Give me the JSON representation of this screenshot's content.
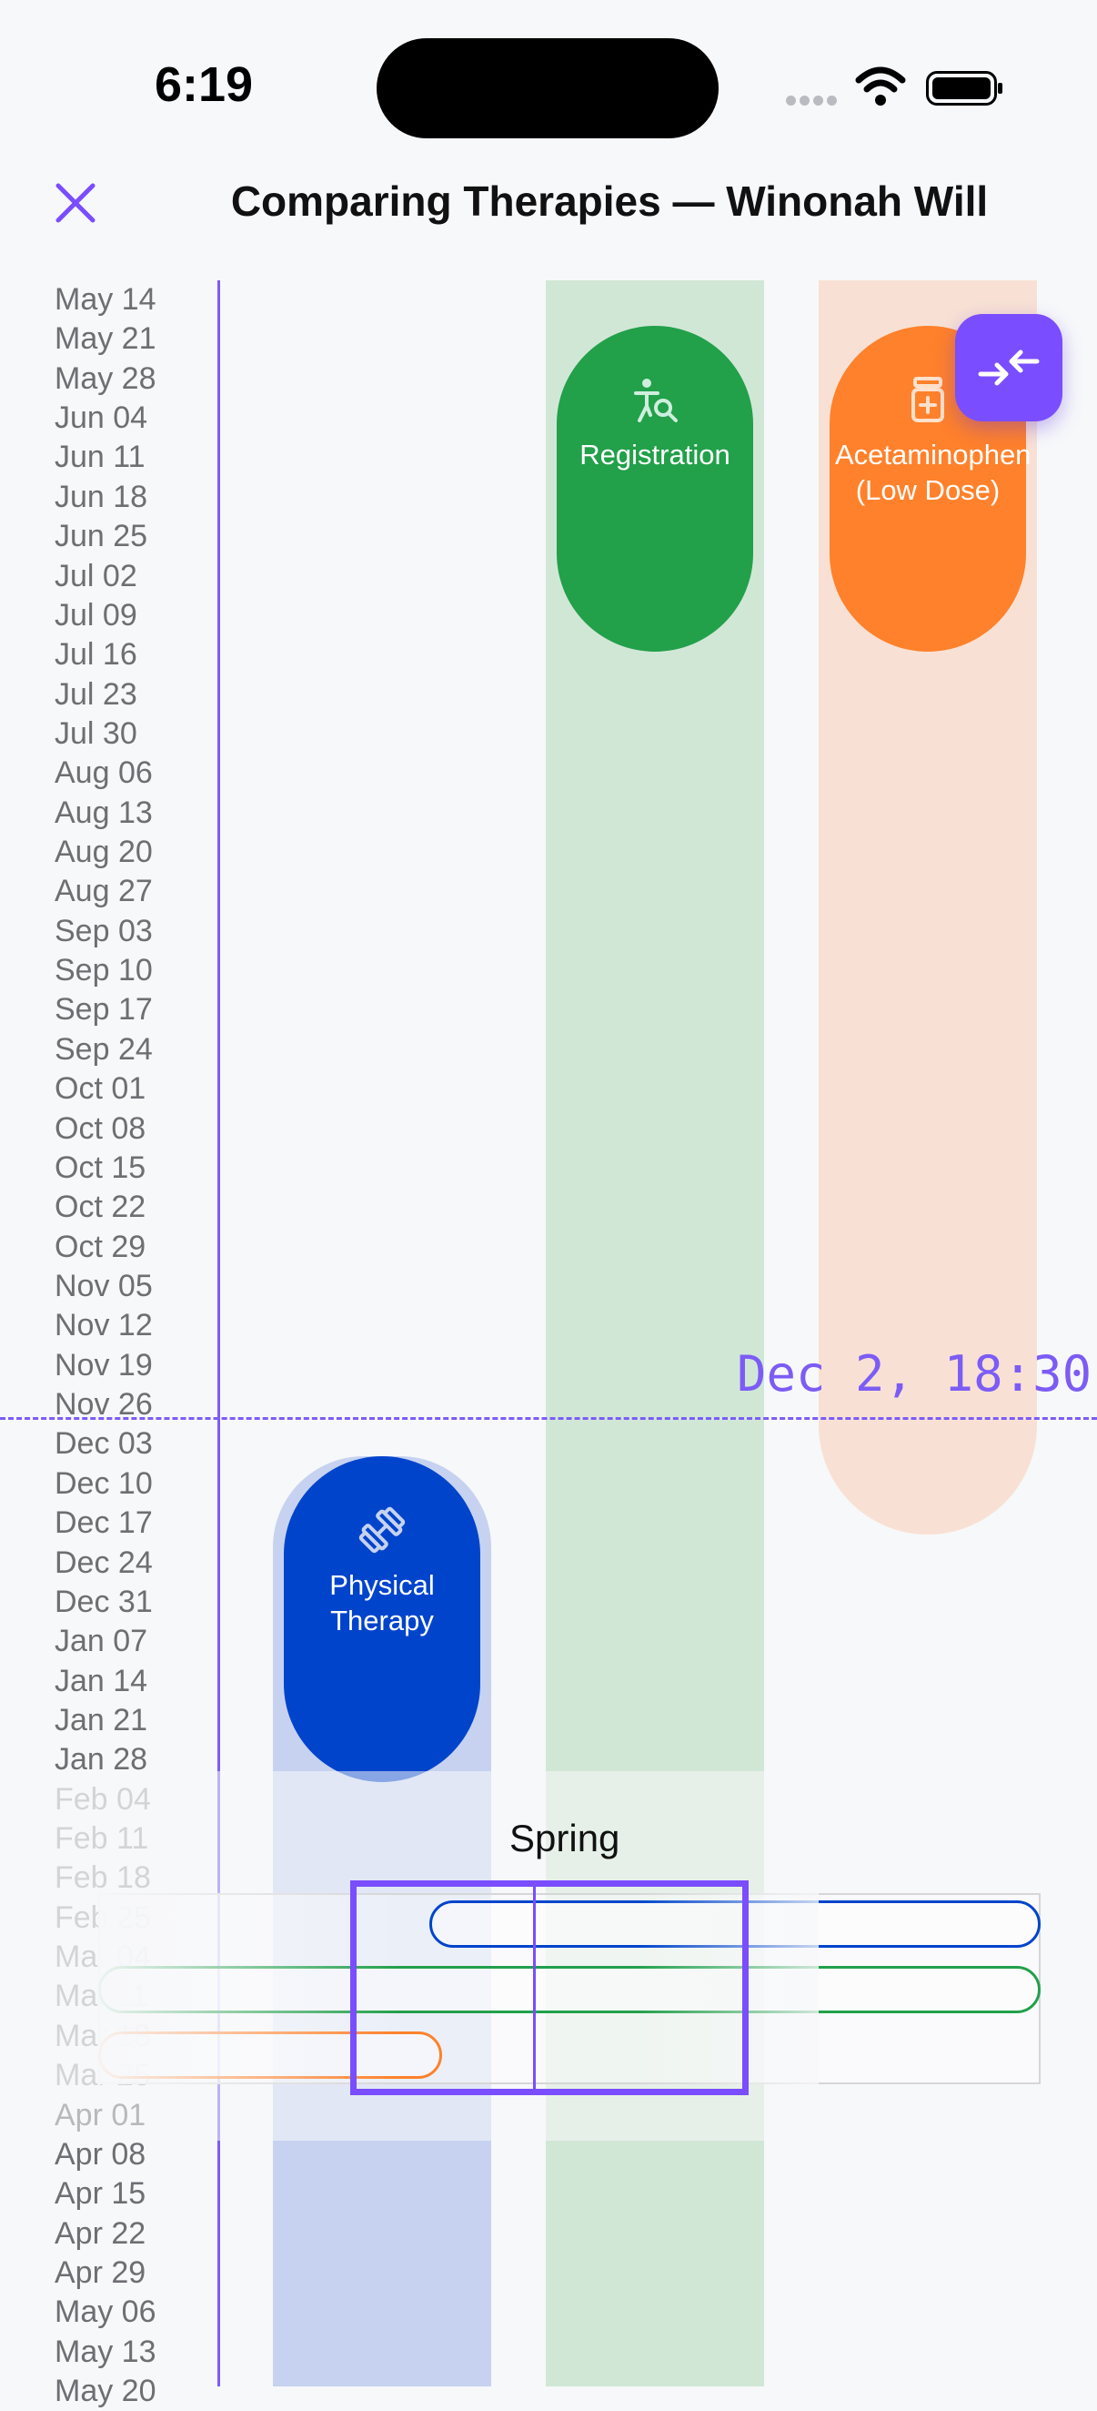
{
  "status_bar": {
    "time": "6:19"
  },
  "header": {
    "title": "Comparing Therapies — Winonah Will"
  },
  "date_axis": {
    "labels": [
      "May 14",
      "May 21",
      "May 28",
      "Jun 04",
      "Jun 11",
      "Jun 18",
      "Jun 25",
      "Jul 02",
      "Jul 09",
      "Jul 16",
      "Jul 23",
      "Jul 30",
      "Aug 06",
      "Aug 13",
      "Aug 20",
      "Aug 27",
      "Sep 03",
      "Sep 10",
      "Sep 17",
      "Sep 24",
      "Oct 01",
      "Oct 08",
      "Oct 15",
      "Oct 22",
      "Oct 29",
      "Nov 05",
      "Nov 12",
      "Nov 19",
      "Nov 26",
      "Dec 03",
      "Dec 10",
      "Dec 17",
      "Dec 24",
      "Dec 31",
      "Jan 07",
      "Jan 14",
      "Jan 21",
      "Jan 28",
      "Feb 04",
      "Feb 11",
      "Feb 18",
      "Feb 25",
      "Mar 04",
      "Mar 11",
      "Mar 18",
      "Mar 25",
      "Apr 01",
      "Apr 08",
      "Apr 15",
      "Apr 22",
      "Apr 29",
      "May 06",
      "May 13",
      "May 20"
    ]
  },
  "now_marker": {
    "label": "Dec 2, 18:30"
  },
  "therapies": {
    "registration": {
      "label": "Registration",
      "icon": "person-search-icon",
      "color": "#22a04a"
    },
    "acetaminophen": {
      "label": "Acetaminophen (Low Dose)",
      "icon": "pill-bottle-icon",
      "color": "#ff812b"
    },
    "physical_therapy": {
      "label": "Physical Therapy",
      "icon": "dumbbell-icon",
      "color": "#0044cc"
    }
  },
  "overview": {
    "season_label": "Spring"
  },
  "colors": {
    "accent": "#7a4dff"
  }
}
